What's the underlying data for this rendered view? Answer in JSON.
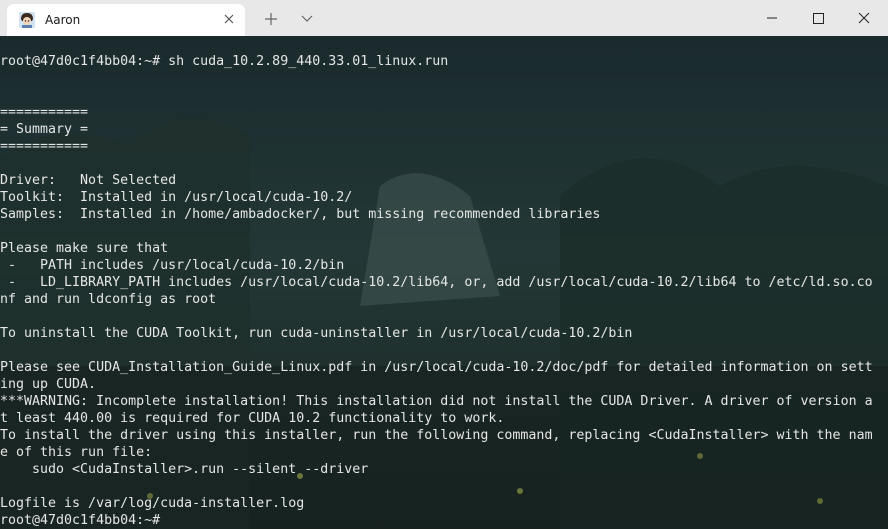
{
  "tab": {
    "title": "Aaron",
    "avatar_icon": "profile-avatar-icon",
    "close_icon": "close-icon"
  },
  "titlebar_buttons": {
    "new_tab_icon": "plus-icon",
    "dropdown_icon": "chevron-down-icon",
    "minimize_icon": "minimize-icon",
    "maximize_icon": "maximize-icon",
    "close_icon": "close-icon"
  },
  "colors": {
    "titlebar": "#e8e8e8",
    "tab": "#ffffff",
    "terminal_text": "#e6e6e6"
  },
  "terminal": {
    "lines": [
      "root@47d0c1f4bb04:~# sh cuda_10.2.89_440.33.01_linux.run",
      "",
      "",
      "===========",
      "= Summary =",
      "===========",
      "",
      "Driver:   Not Selected",
      "Toolkit:  Installed in /usr/local/cuda-10.2/",
      "Samples:  Installed in /home/ambadocker/, but missing recommended libraries",
      "",
      "Please make sure that",
      " -   PATH includes /usr/local/cuda-10.2/bin",
      " -   LD_LIBRARY_PATH includes /usr/local/cuda-10.2/lib64, or, add /usr/local/cuda-10.2/lib64 to /etc/ld.so.co",
      "nf and run ldconfig as root",
      "",
      "To uninstall the CUDA Toolkit, run cuda-uninstaller in /usr/local/cuda-10.2/bin",
      "",
      "Please see CUDA_Installation_Guide_Linux.pdf in /usr/local/cuda-10.2/doc/pdf for detailed information on sett",
      "ing up CUDA.",
      "***WARNING: Incomplete installation! This installation did not install the CUDA Driver. A driver of version a",
      "t least 440.00 is required for CUDA 10.2 functionality to work.",
      "To install the driver using this installer, run the following command, replacing <CudaInstaller> with the nam",
      "e of this run file:",
      "    sudo <CudaInstaller>.run --silent --driver",
      "",
      "Logfile is /var/log/cuda-installer.log",
      "root@47d0c1f4bb04:~#"
    ]
  }
}
